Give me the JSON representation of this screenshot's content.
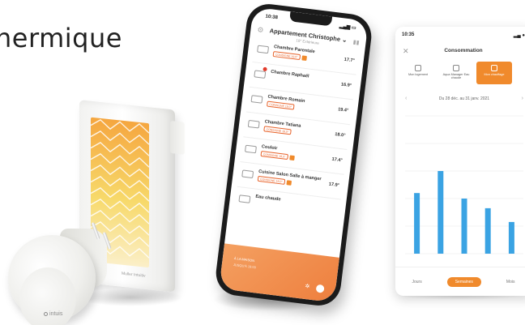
{
  "heading": "hermique",
  "radiator": {
    "brand": "Muller Intuitiv"
  },
  "plug": {
    "brand": "intuis"
  },
  "phone": {
    "time": "10:38",
    "title": "Appartement Christophe",
    "subtitle": "19° Extérieure",
    "rooms": [
      {
        "name": "Chambre Parentale",
        "temp": "17.7°",
        "tag": "CONSIGNE 19,0°",
        "alert": false
      },
      {
        "name": "Chambre Raphaël",
        "temp": "16.9°",
        "tag": "",
        "alert": true
      },
      {
        "name": "Chambre Romain",
        "temp": "19.4°",
        "tag": "CONSIGNE 19,0°",
        "alert": false
      },
      {
        "name": "Chambre Tatiana",
        "temp": "18.0°",
        "tag": "CONSIGNE 18,0°",
        "alert": false
      },
      {
        "name": "Couloir",
        "temp": "17.4°",
        "tag": "CONSIGNE 18,0°",
        "alert": false
      },
      {
        "name": "Cuisine Salon Salle à manger",
        "temp": "17.9°",
        "tag": "CONSIGNE 18,0°",
        "alert": false
      },
      {
        "name": "Eau chaude",
        "temp": "",
        "tag": "",
        "alert": false
      }
    ],
    "footer": {
      "line1": "À LA MAISON",
      "line2": "JUSQU'À 19:00"
    }
  },
  "consumption": {
    "time": "10:35",
    "title": "Consommation",
    "tabs": [
      {
        "label": "Mon logement"
      },
      {
        "label": "Aqua Manager Eau chaude"
      },
      {
        "label": "Mon chauffage"
      }
    ],
    "range": "Du 28 déc. au 31 janv. 2021",
    "buttons": [
      "Jours",
      "Semaines",
      "Mois"
    ],
    "colors": {
      "accent": "#f08a2c",
      "bar": "#3aa3e3"
    },
    "chart_data": {
      "type": "bar",
      "categories": [
        "",
        "",
        "",
        "",
        ""
      ],
      "values": [
        44,
        60,
        40,
        33,
        23
      ],
      "title": "",
      "xlabel": "",
      "ylabel": "",
      "ylim": [
        0,
        100
      ],
      "grid": true
    }
  }
}
